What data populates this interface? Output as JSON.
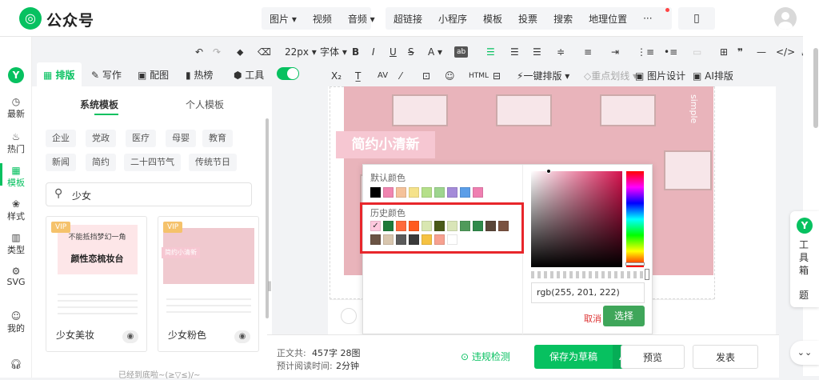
{
  "app": {
    "name": "公众号"
  },
  "top_menu": {
    "media": [
      "图片 ▾",
      "视频",
      "音频 ▾"
    ],
    "insert": [
      "超链接",
      "小程序",
      "模板",
      "投票",
      "搜索",
      "地理位置",
      "···"
    ]
  },
  "toolbar1": {
    "font_size": "22px ▾",
    "font_family": "字体 ▾",
    "items": [
      "B",
      "I",
      "U",
      "S",
      "A ▾"
    ]
  },
  "toolbar2": {
    "one_click": "一键排版 ▾",
    "highlight": "重点划线 ▾",
    "image_design": "图片设计",
    "ai_layout": "AI排版"
  },
  "panel_tabs": [
    "排版",
    "写作",
    "配图",
    "热榜",
    "工具"
  ],
  "rail": [
    "最新",
    "热门",
    "模板",
    "样式",
    "类型",
    "SVG",
    "我的"
  ],
  "template_tabs": {
    "system": "系统模板",
    "personal": "个人模板"
  },
  "categories": [
    "企业",
    "党政",
    "医疗",
    "母婴",
    "教育",
    "新闻",
    "简约",
    "二十四节气",
    "传统节日"
  ],
  "search": {
    "value": "少女"
  },
  "cards": [
    {
      "label": "少女美妆",
      "vip": "VIP",
      "line1": "不能抵挡梦幻一角",
      "line2": "颜性恋梳妆台"
    },
    {
      "label": "少女粉色",
      "vip": "VIP",
      "badge": "简约小清新"
    }
  ],
  "list_end": "已经到底啦~(≥▽≤)/~",
  "article": {
    "title": "简约小清新",
    "side_text": "simple"
  },
  "picker": {
    "default_label": "默认颜色",
    "history_label": "历史颜色",
    "default_colors": [
      "#000000",
      "#f085b0",
      "#f5c29a",
      "#f5e28a",
      "#b5e08a",
      "#9ed58f",
      "#a48bd9",
      "#5b9ee8",
      "#ef7fb1"
    ],
    "history_colors": [
      "#ffc9de",
      "#1f7a3a",
      "#ff6a3c",
      "#ff5a1e",
      "#d9e7b1",
      "#4a5a18",
      "#d9e5b8",
      "#4f9a5a",
      "#2f8a4a",
      "#5a4638",
      "#7a5240",
      "#6b5444",
      "#d8c6ae",
      "#5a5a5a",
      "#3a3a3a",
      "#f5c242",
      "#f7a190",
      "#ffffff"
    ],
    "rgb_value": "rgb(255, 201, 222)",
    "cancel": "取消",
    "confirm": "选择"
  },
  "bottom": {
    "word_count_label": "正文共:",
    "word_count_value": "457字 28图",
    "read_time_label": "预计阅读时间:",
    "read_time_value": "2分钟",
    "violation_check": "违规检测",
    "save_draft": "保存为草稿",
    "preview": "预览",
    "publish": "发表"
  },
  "toolbox": {
    "label": "工具箱",
    "topic": "题"
  },
  "colors": {
    "brand_green": "#07c160",
    "highlight_red": "#e8262b",
    "confirm_green": "#3fa65a"
  }
}
